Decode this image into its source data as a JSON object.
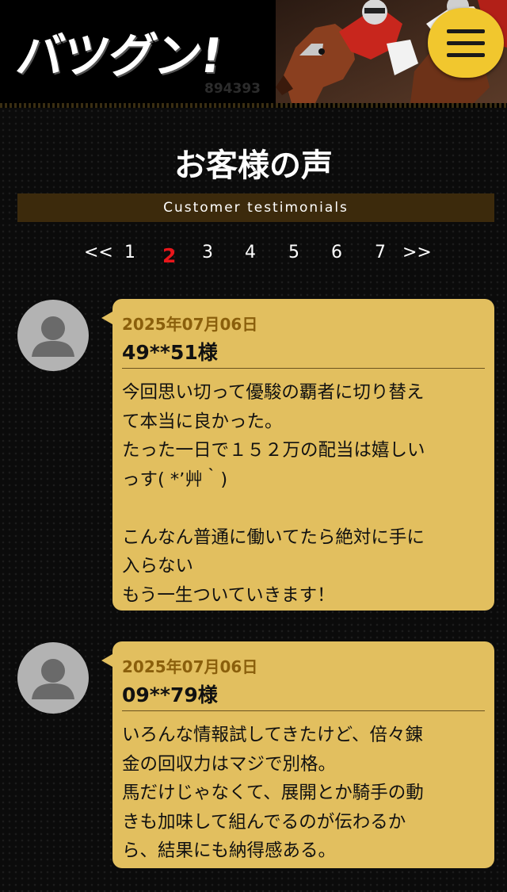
{
  "header": {
    "logo_text": "バツグン!",
    "logo_number": "894393",
    "menu_icon": "hamburger-icon"
  },
  "title": "お客様の声",
  "subtitle": "Customer testimonials",
  "pagination": {
    "prev": "<<",
    "pages": [
      "1",
      "2",
      "3",
      "4",
      "5",
      "6",
      "7"
    ],
    "current": "2",
    "next": ">>"
  },
  "testimonials": [
    {
      "date": "2025年07月06日",
      "name": "49**51様",
      "body": "今回思い切って優駿の覇者に切り替え\nて本当に良かった。\nたった一日で１５２万の配当は嬉しい\nっす( *ʼ艸｀)\n\nこんなん普通に働いてたら絶対に手に\n入らない\nもう一生ついていきます！"
    },
    {
      "date": "2025年07月06日",
      "name": "09**79様",
      "body": "いろんな情報試してきたけど、倍々錬\n金の回収力はマジで別格。\n馬だけじゃなくて、展開とか騎手の動\nきも加味して組んでるのが伝わるか\nら、結果にも納得感ある。"
    }
  ],
  "colors": {
    "accent": "#f1c72e",
    "card": "#e2bf5f",
    "active_page": "#e8161b",
    "subtitle_bar": "#3c2a0c"
  }
}
